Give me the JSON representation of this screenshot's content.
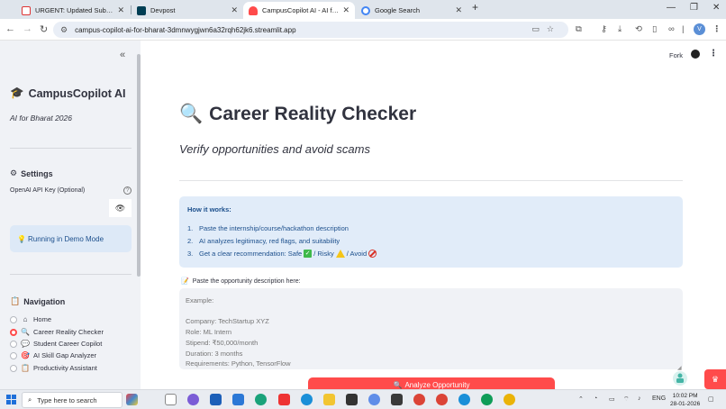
{
  "browser": {
    "tabs": [
      {
        "title": "URGENT: Updated Submission",
        "favicon": "gmail-icon"
      },
      {
        "title": "Devpost",
        "favicon": "devpost-icon"
      },
      {
        "title": "CampusCopilot AI - AI for Bharat",
        "favicon": "streamlit-icon",
        "active": true
      },
      {
        "title": "Google Search",
        "favicon": "google-icon"
      }
    ],
    "new_tab": "+",
    "url": "campus-copilot-ai-for-bharat-3dmnwygjwn6a32rqh62jk6.streamlit.app",
    "profile_initial": "V"
  },
  "sidebar": {
    "collapse_glyph": "«",
    "app_title": "CampusCopilot AI",
    "app_subtitle": "AI for Bharat 2026",
    "settings_heading": "Settings",
    "api_key_label": "OpenAI API Key (Optional)",
    "api_key_value": "",
    "demo_mode_text": "Running in Demo Mode",
    "navigation_heading": "Navigation",
    "nav_items": [
      {
        "label": "Home",
        "icon": "house-icon",
        "selected": false
      },
      {
        "label": "Career Reality Checker",
        "icon": "magnifier-icon",
        "selected": true
      },
      {
        "label": "Student Career Copilot",
        "icon": "chat-icon",
        "selected": false
      },
      {
        "label": "AI Skill Gap Analyzer",
        "icon": "target-icon",
        "selected": false
      },
      {
        "label": "Productivity Assistant",
        "icon": "clipboard-icon",
        "selected": false
      }
    ]
  },
  "header": {
    "fork_label": "Fork"
  },
  "main": {
    "title": "Career Reality Checker",
    "subtitle": "Verify opportunities and avoid scams",
    "howto_title": "How it works:",
    "steps": [
      {
        "num": "1.",
        "text": "Paste the internship/course/hackathon description"
      },
      {
        "num": "2.",
        "text": "AI analyzes legitimacy, red flags, and suitability"
      },
      {
        "num": "3.",
        "text": "Get a clear recommendation: Safe",
        "risky": "/ Risky",
        "avoid": "/ Avoid"
      }
    ],
    "description_label": "Paste the opportunity description here:",
    "description_placeholder": "Example:\n\nCompany: TechStartup XYZ\nRole: ML Intern\nStipend: ₹50,000/month\nDuration: 3 months\nRequirements: Python, TensorFlow",
    "analyze_button": "Analyze Opportunity"
  },
  "taskbar": {
    "search_placeholder": "Type here to search",
    "language": "ENG",
    "time": "10:02 PM",
    "date": "28-01-2026"
  },
  "colors": {
    "accent": "#ff4b4b",
    "sidebar_bg": "#f0f2f6",
    "info_bg": "#e1ecf9",
    "info_text": "#1c4f8c"
  }
}
